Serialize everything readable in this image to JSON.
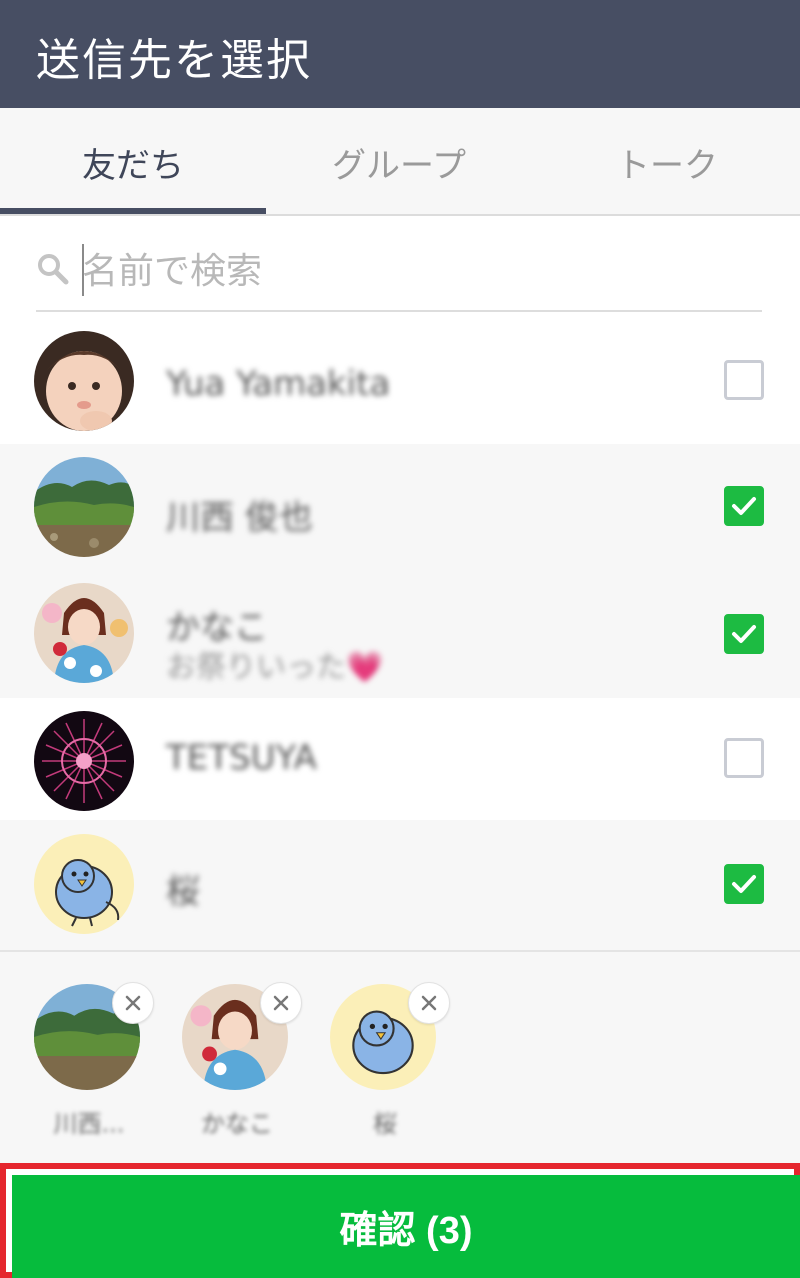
{
  "header": {
    "title": "送信先を選択"
  },
  "tabs": [
    {
      "label": "友だち",
      "active": true
    },
    {
      "label": "グループ",
      "active": false
    },
    {
      "label": "トーク",
      "active": false
    }
  ],
  "search": {
    "placeholder": "名前で検索",
    "value": ""
  },
  "friends": [
    {
      "name": "Yua Yamakita",
      "status": "",
      "checked": false,
      "avatar": "baby-photo"
    },
    {
      "name": "川西 俊也",
      "status": "",
      "checked": true,
      "avatar": "mountain-photo"
    },
    {
      "name": "かなこ",
      "status": "お祭りいった💗",
      "checked": true,
      "avatar": "yukata-girl-photo"
    },
    {
      "name": "TETSUYA",
      "status": "",
      "checked": false,
      "avatar": "fireworks-photo"
    },
    {
      "name": "桜",
      "status": "",
      "checked": true,
      "avatar": "blue-bird-illustration"
    }
  ],
  "selected": [
    {
      "label": "川西...",
      "avatar": "mountain-photo"
    },
    {
      "label": "かなこ",
      "avatar": "yukata-girl-photo"
    },
    {
      "label": "桜",
      "avatar": "blue-bird-illustration"
    }
  ],
  "confirm": {
    "label": "確認 (3)"
  },
  "icons": {
    "search": "search-icon",
    "check": "check-icon",
    "remove": "close-icon"
  },
  "colors": {
    "header": "#474e63",
    "accent_green": "#06bc3d",
    "highlight_border": "#e5262e"
  }
}
